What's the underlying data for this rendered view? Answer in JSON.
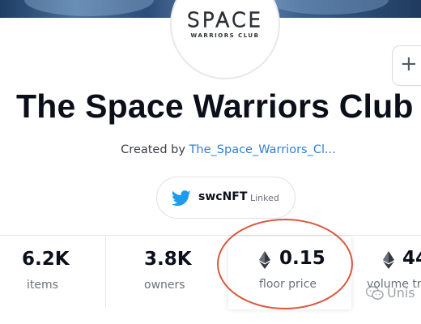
{
  "collection": {
    "logo_title": "SPACE",
    "logo_subtitle": "WARRIORS CLUB",
    "title": "The Space Warriors Club",
    "created_by_prefix": "Created by",
    "creator_name": "The_Space_Warriors_Cl..."
  },
  "social": {
    "icon": "twitter-icon",
    "handle": "swcNFT",
    "status": "Linked"
  },
  "actions": {
    "side_button_icon": "plus-icon",
    "side_button_label": "+"
  },
  "stats": [
    {
      "value": "6.2K",
      "label": "items"
    },
    {
      "value": "3.8K",
      "label": "owners"
    },
    {
      "value": "0.15",
      "label": "floor price",
      "currency_icon": "ethereum-icon"
    },
    {
      "value": "44",
      "label": "volume tr",
      "currency_icon": "ethereum-icon"
    }
  ],
  "annotation": {
    "color": "#d9563d",
    "shape": "ellipse around floor price"
  },
  "watermark": {
    "text": "Unis",
    "icon": "wechat-icon"
  },
  "colors": {
    "link": "#2f7fd6",
    "twitter": "#1d9bf0",
    "title": "#0b0f1a",
    "muted": "#6a717c"
  }
}
